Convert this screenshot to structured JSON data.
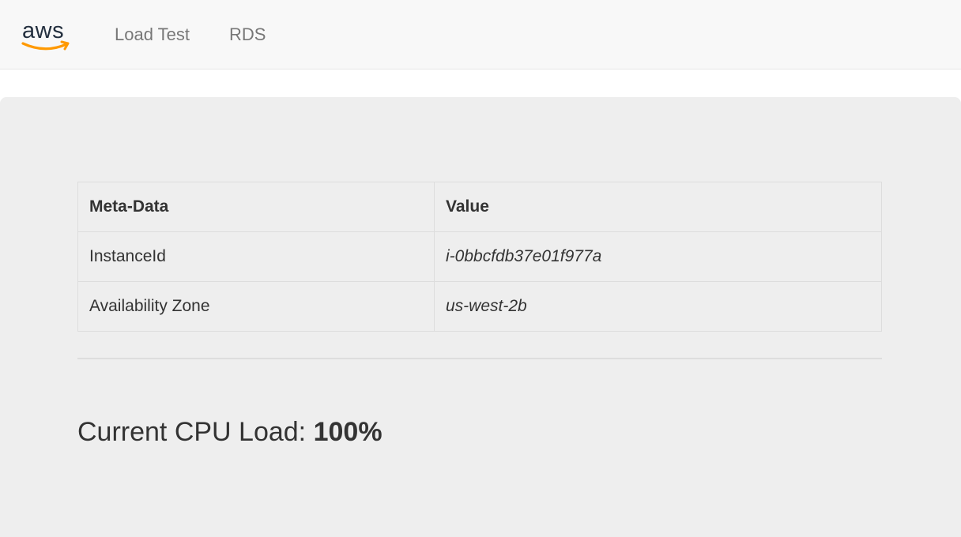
{
  "brand": {
    "logo_text": "aws",
    "logo_color": "#232f3e",
    "smile_color": "#ff9900"
  },
  "nav": {
    "links": [
      {
        "label": "Load Test"
      },
      {
        "label": "RDS"
      }
    ]
  },
  "meta_table": {
    "headers": [
      "Meta-Data",
      "Value"
    ],
    "rows": [
      {
        "key": "InstanceId",
        "value": "i-0bbcfdb37e01f977a"
      },
      {
        "key": "Availability Zone",
        "value": "us-west-2b"
      }
    ]
  },
  "cpu": {
    "label": "Current CPU Load: ",
    "value": "100%"
  }
}
